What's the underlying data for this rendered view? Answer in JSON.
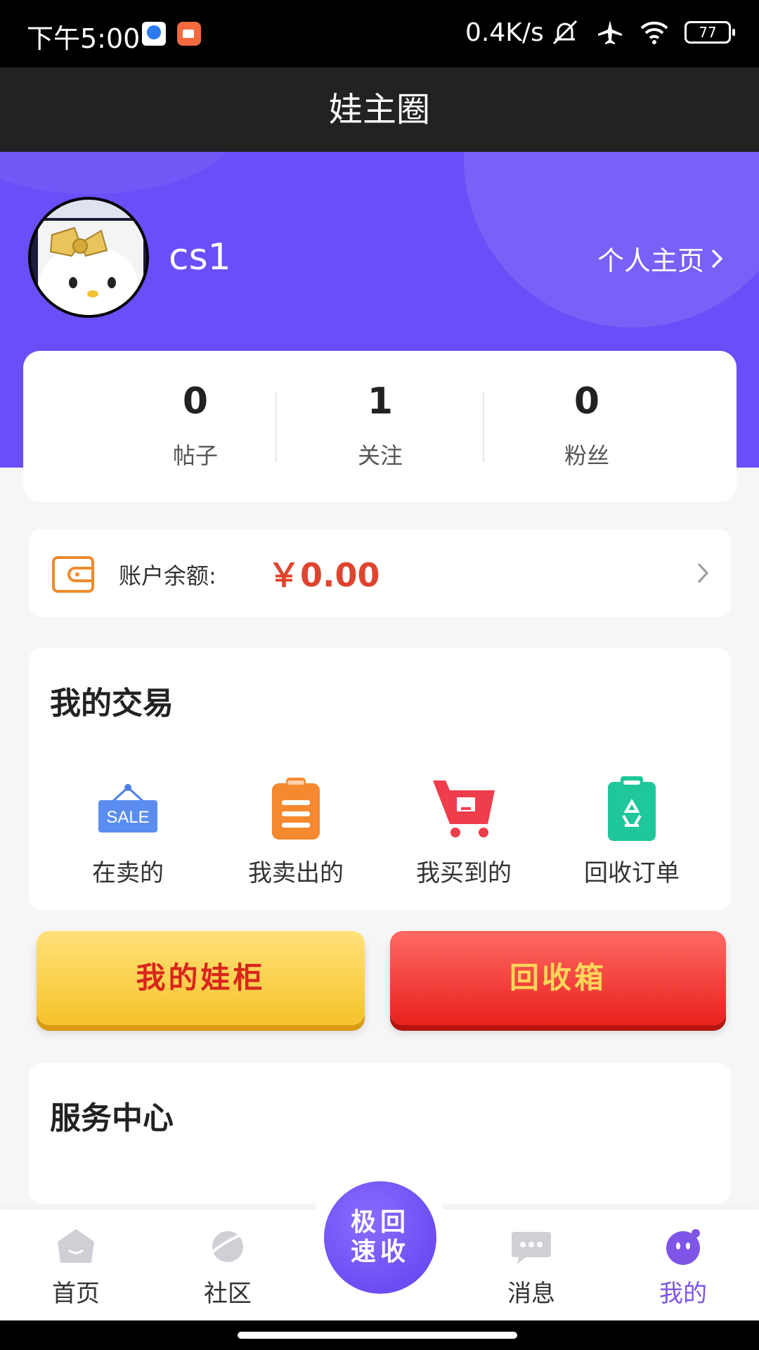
{
  "status_bar": {
    "time": "下午5:00",
    "net_speed": "0.4K/s",
    "battery": "77"
  },
  "header": {
    "title": "娃主圈"
  },
  "profile": {
    "username": "cs1",
    "profile_link": "个人主页"
  },
  "stats": [
    {
      "value": "0",
      "label": "帖子"
    },
    {
      "value": "1",
      "label": "关注"
    },
    {
      "value": "0",
      "label": "粉丝"
    }
  ],
  "balance": {
    "label": "账户余额:",
    "value": "￥0.00",
    "color": "#e0442f"
  },
  "trade": {
    "title": "我的交易",
    "items": [
      {
        "label": "在卖的",
        "icon": "sale-sign-icon",
        "icon_text": "SALE"
      },
      {
        "label": "我卖出的",
        "icon": "clipboard-icon"
      },
      {
        "label": "我买到的",
        "icon": "shopping-cart-icon"
      },
      {
        "label": "回收订单",
        "icon": "recycle-clipboard-icon"
      }
    ]
  },
  "buttons": {
    "doll_cabinet": "我的娃柜",
    "recycle_bin": "回收箱"
  },
  "service": {
    "title": "服务中心"
  },
  "nav": {
    "items": [
      {
        "label": "首页",
        "icon": "home-face-icon"
      },
      {
        "label": "社区",
        "icon": "planet-icon"
      },
      {
        "label": "消息",
        "icon": "chat-bubble-icon"
      },
      {
        "label": "我的",
        "icon": "profile-face-icon"
      }
    ],
    "center_label": "极回速收",
    "active_color": "#7f55e8"
  },
  "colors": {
    "brand_purple": "#6a4ef7",
    "title_bar": "#222222"
  }
}
